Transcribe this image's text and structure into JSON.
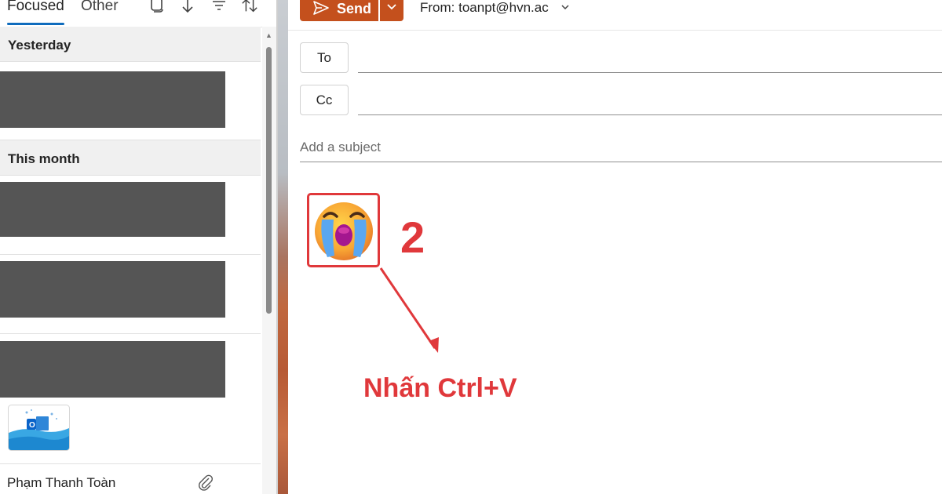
{
  "mail_list": {
    "tabs": [
      {
        "label": "Focused",
        "active": true
      },
      {
        "label": "Other",
        "active": false
      }
    ],
    "toolbar_icons": [
      "select-icon",
      "arrow-down-icon",
      "filter-icon",
      "sort-icon"
    ],
    "groups": [
      {
        "label": "Yesterday"
      },
      {
        "label": "This month"
      }
    ],
    "last_item": {
      "sender": "Phạm Thanh Toàn",
      "icons": [
        "outlook-thumbnail-icon",
        "paperclip-icon"
      ]
    }
  },
  "compose": {
    "send_label": "Send",
    "from_label": "From: toanpt@hvn.ac",
    "to_label": "To",
    "cc_label": "Cc",
    "to_value": "",
    "cc_value": "",
    "subject_placeholder": "Add a subject",
    "body_content": "loudly-crying-face-emoji-icon"
  },
  "annotation": {
    "step_number": "2",
    "instruction": "Nhấn Ctrl+V",
    "color": "#e0383b"
  },
  "colors": {
    "send_button": "#c4501d",
    "accent_tab": "#0f6cbd",
    "redaction": "#555555"
  }
}
